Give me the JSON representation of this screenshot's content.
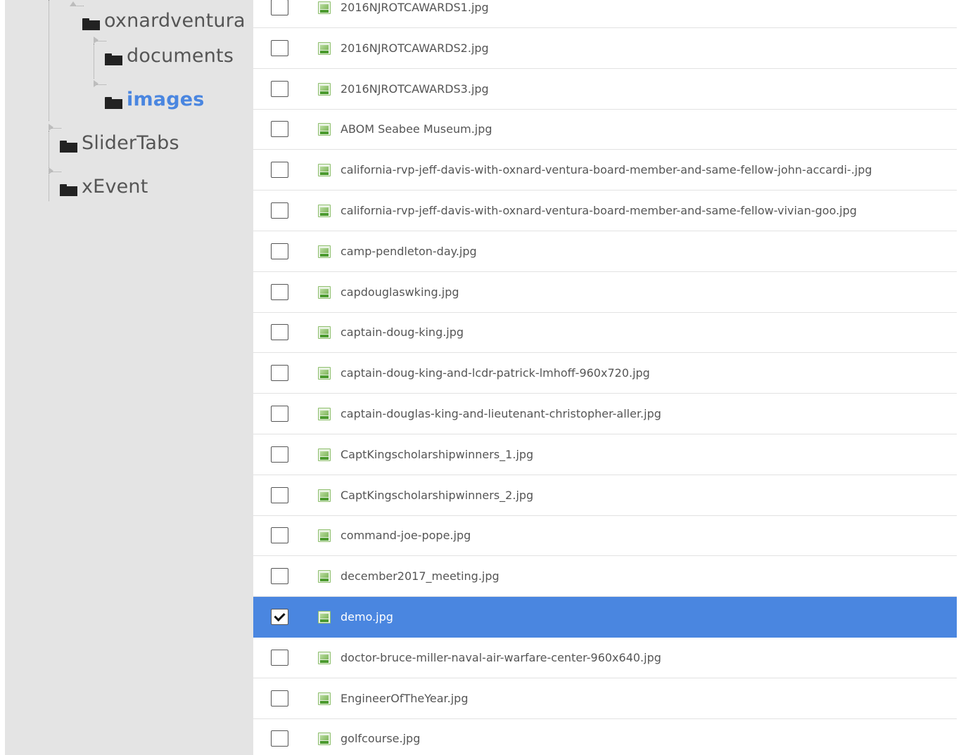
{
  "tree": {
    "nodes": [
      {
        "label": "oxnardventura",
        "icon": "folder-icon",
        "expander": "open",
        "selected": false
      },
      {
        "label": "documents",
        "icon": "folder-icon",
        "expander": "closed",
        "selected": false
      },
      {
        "label": "images",
        "icon": "folder-icon",
        "expander": "closed",
        "selected": true
      },
      {
        "label": "SliderTabs",
        "icon": "folder-icon",
        "expander": "closed",
        "selected": false
      },
      {
        "label": "xEvent",
        "icon": "folder-icon",
        "expander": "closed",
        "selected": false
      }
    ]
  },
  "files": {
    "rows": [
      {
        "name": "2016NJROTCAWARDS1.jpg",
        "checked": false,
        "icon": "image-file-icon"
      },
      {
        "name": "2016NJROTCAWARDS2.jpg",
        "checked": false,
        "icon": "image-file-icon"
      },
      {
        "name": "2016NJROTCAWARDS3.jpg",
        "checked": false,
        "icon": "image-file-icon"
      },
      {
        "name": "ABOM Seabee Museum.jpg",
        "checked": false,
        "icon": "image-file-icon"
      },
      {
        "name": "california-rvp-jeff-davis-with-oxnard-ventura-board-member-and-same-fellow-john-accardi-.jpg",
        "checked": false,
        "icon": "image-file-icon"
      },
      {
        "name": "california-rvp-jeff-davis-with-oxnard-ventura-board-member-and-same-fellow-vivian-goo.jpg",
        "checked": false,
        "icon": "image-file-icon"
      },
      {
        "name": "camp-pendleton-day.jpg",
        "checked": false,
        "icon": "image-file-icon"
      },
      {
        "name": "capdouglaswking.jpg",
        "checked": false,
        "icon": "image-file-icon"
      },
      {
        "name": "captain-doug-king.jpg",
        "checked": false,
        "icon": "image-file-icon"
      },
      {
        "name": "captain-doug-king-and-lcdr-patrick-lmhoff-960x720.jpg",
        "checked": false,
        "icon": "image-file-icon"
      },
      {
        "name": "captain-douglas-king-and-lieutenant-christopher-aller.jpg",
        "checked": false,
        "icon": "image-file-icon"
      },
      {
        "name": "CaptKingscholarshipwinners_1.jpg",
        "checked": false,
        "icon": "image-file-icon"
      },
      {
        "name": "CaptKingscholarshipwinners_2.jpg",
        "checked": false,
        "icon": "image-file-icon"
      },
      {
        "name": "command-joe-pope.jpg",
        "checked": false,
        "icon": "image-file-icon"
      },
      {
        "name": "december2017_meeting.jpg",
        "checked": false,
        "icon": "image-file-icon"
      },
      {
        "name": "demo.jpg",
        "checked": true,
        "icon": "image-file-icon"
      },
      {
        "name": "doctor-bruce-miller-naval-air-warfare-center-960x640.jpg",
        "checked": false,
        "icon": "image-file-icon"
      },
      {
        "name": "EngineerOfTheYear.jpg",
        "checked": false,
        "icon": "image-file-icon"
      },
      {
        "name": "golfcourse.jpg",
        "checked": false,
        "icon": "image-file-icon"
      }
    ]
  },
  "colors": {
    "selected_row": "#4a86e0",
    "selected_folder_text": "#4a86e0",
    "tree_background": "#e4e4e4"
  }
}
